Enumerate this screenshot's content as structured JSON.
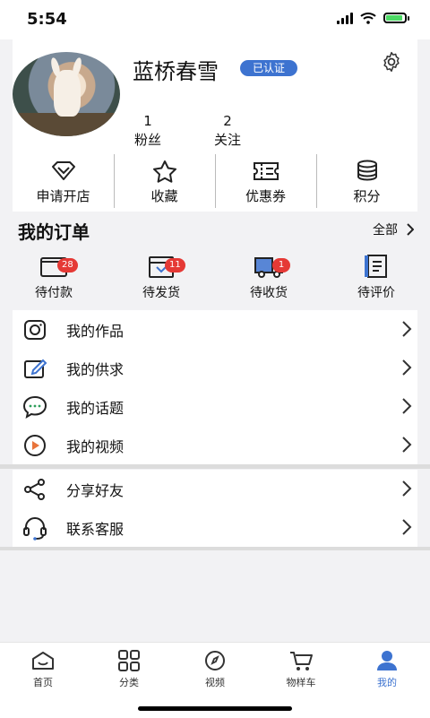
{
  "status": {
    "time": "5:54"
  },
  "profile": {
    "username": "蓝桥春雪",
    "verified_label": "已认证",
    "stats": [
      {
        "count": "1",
        "label": "粉丝"
      },
      {
        "count": "2",
        "label": "关注"
      }
    ]
  },
  "quick_actions": [
    {
      "label": "申请开店",
      "icon": "diamond-icon"
    },
    {
      "label": "收藏",
      "icon": "star-icon"
    },
    {
      "label": "优惠券",
      "icon": "coupon-icon"
    },
    {
      "label": "积分",
      "icon": "coins-icon"
    }
  ],
  "orders": {
    "title": "我的订单",
    "all_label": "全部",
    "items": [
      {
        "label": "待付款",
        "badge": "28",
        "icon": "wallet-icon"
      },
      {
        "label": "待发货",
        "badge": "11",
        "icon": "box-icon"
      },
      {
        "label": "待收货",
        "badge": "1",
        "icon": "truck-icon"
      },
      {
        "label": "待评价",
        "badge": "",
        "icon": "review-icon"
      }
    ]
  },
  "menu": [
    {
      "label": "我的作品",
      "icon": "camera-icon"
    },
    {
      "label": "我的供求",
      "icon": "edit-icon"
    },
    {
      "label": "我的话题",
      "icon": "chat-icon"
    },
    {
      "label": "我的视频",
      "icon": "video-icon"
    }
  ],
  "menu2": [
    {
      "label": "分享好友",
      "icon": "share-icon"
    },
    {
      "label": "联系客服",
      "icon": "headset-icon"
    }
  ],
  "tabbar": [
    {
      "label": "首页",
      "icon": "home-icon"
    },
    {
      "label": "分类",
      "icon": "grid-icon"
    },
    {
      "label": "视频",
      "icon": "compass-icon"
    },
    {
      "label": "物样车",
      "icon": "cart-icon"
    },
    {
      "label": "我的",
      "icon": "user-icon"
    }
  ],
  "colors": {
    "accent": "#3d73d0",
    "badge": "#e53935"
  }
}
